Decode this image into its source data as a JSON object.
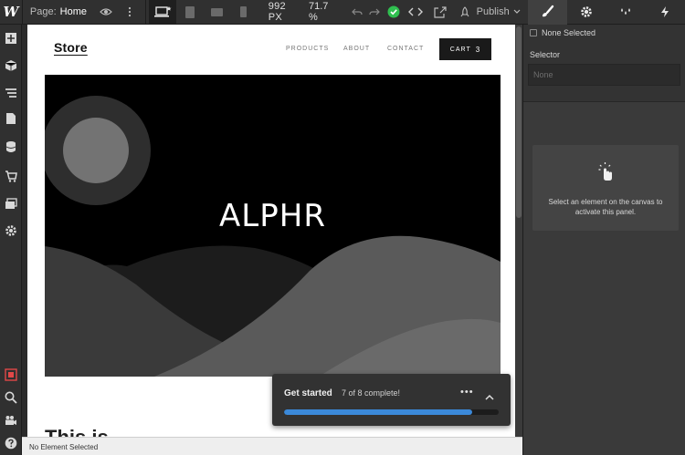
{
  "topbar": {
    "logo": "W",
    "page_label": "Page:",
    "page_name": "Home",
    "width_readout": "992 PX",
    "zoom_readout": "71.7 %",
    "publish_label": "Publish"
  },
  "canvas": {
    "brand": "Store",
    "nav_links": [
      "PRODUCTS",
      "ABOUT",
      "CONTACT"
    ],
    "cart_label": "CART",
    "cart_count": "3",
    "hero_title": "ALPHR",
    "below_text": "This is"
  },
  "right_panel": {
    "none_selected": "None Selected",
    "selector_label": "Selector",
    "selector_placeholder": "None",
    "empty_message": "Select an element on the canvas to activate this panel."
  },
  "status_bar": {
    "text": "No Element Selected"
  },
  "get_started": {
    "title": "Get started",
    "progress_text": "7 of 8 complete!",
    "completed": 7,
    "total": 8
  },
  "colors": {
    "accent_blue": "#3b89d9",
    "success_green": "#2fbf4f",
    "stop_red": "#e04848"
  }
}
